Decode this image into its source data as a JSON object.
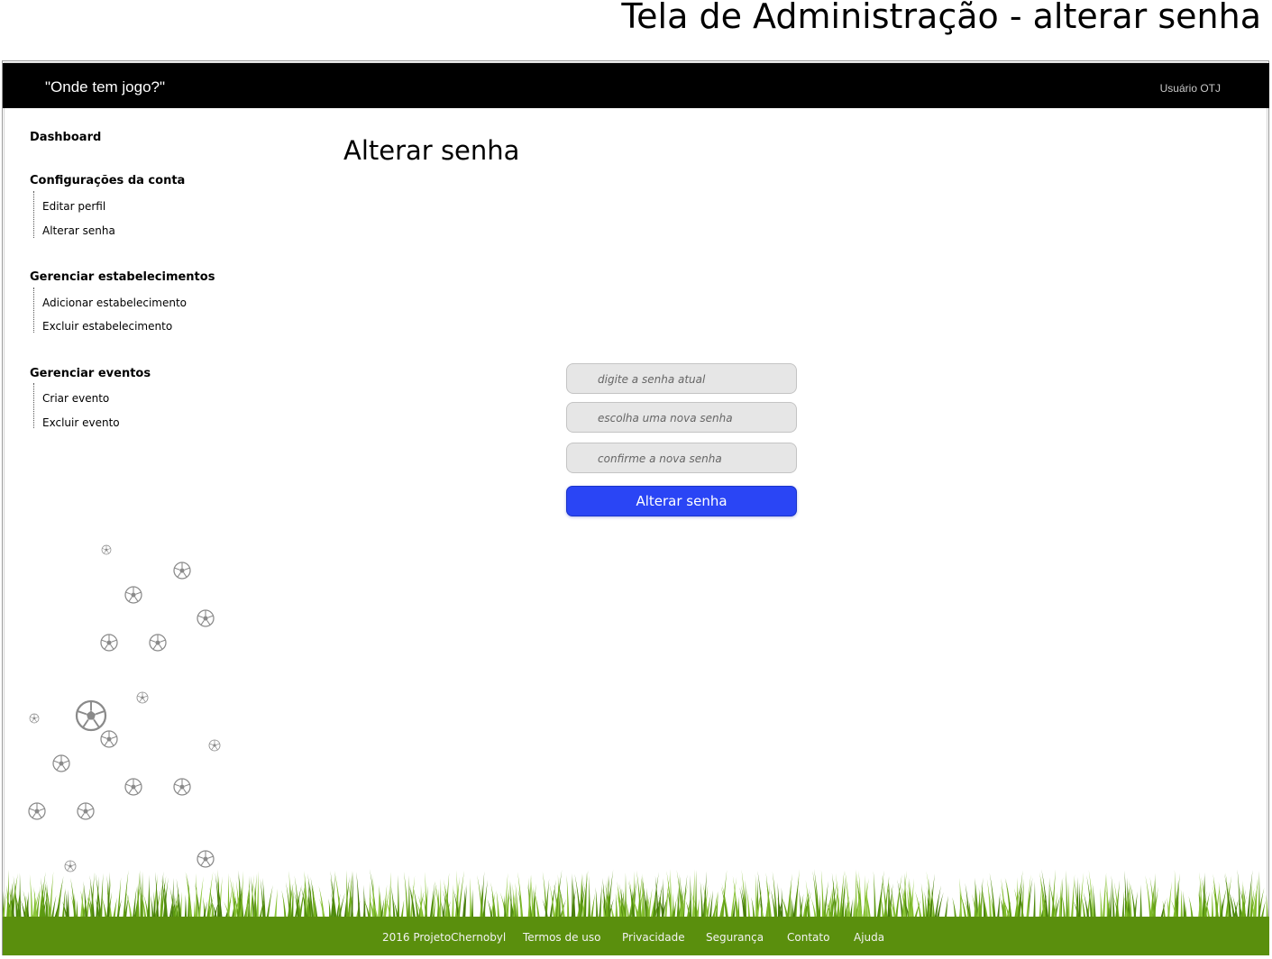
{
  "page_title": "Tela de Administração - alterar senha",
  "header": {
    "brand": "\"Onde tem jogo?\"",
    "user": "Usuário OTJ"
  },
  "nav": {
    "dashboard": "Dashboard",
    "sections": [
      {
        "label": "Configurações da conta",
        "items": [
          "Editar perfil",
          "Alterar senha"
        ]
      },
      {
        "label": "Gerenciar estabelecimentos",
        "items": [
          "Adicionar estabelecimento",
          "Excluir estabelecimento"
        ]
      },
      {
        "label": "Gerenciar eventos",
        "items": [
          "Criar evento",
          "Excluir evento"
        ]
      }
    ]
  },
  "main": {
    "title": "Alterar senha",
    "current_password_placeholder": "digite a senha atual",
    "new_password_placeholder": "escolha uma nova senha",
    "confirm_password_placeholder": "confirme a nova senha",
    "submit_label": "Alterar senha"
  },
  "footer": {
    "copyright": "2016 ProjetoChernobyl",
    "links": [
      "Termos de uso",
      "Privacidade",
      "Segurança",
      "Contato",
      "Ajuda"
    ]
  },
  "colors": {
    "accent_button": "#2a45f5",
    "footer_green": "#5a8f0d",
    "header_black": "#000000"
  },
  "icons": [
    "soccer-ball-icon",
    "grass-decoration"
  ]
}
